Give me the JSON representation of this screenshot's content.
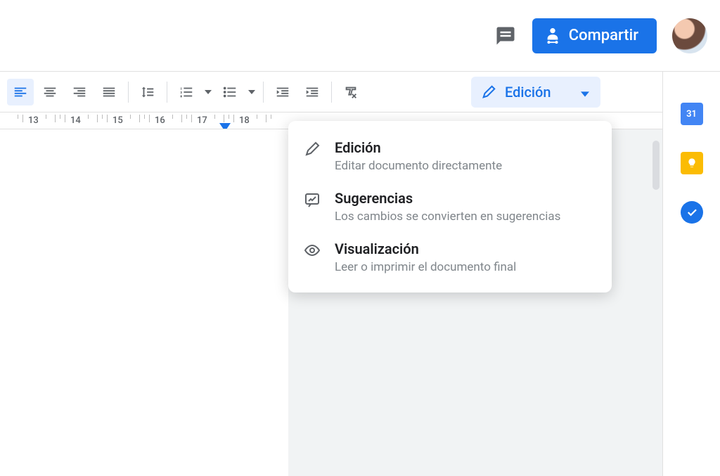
{
  "colors": {
    "primary": "#1a73e8",
    "primary_light": "#e8f0fe"
  },
  "header": {
    "share_label": "Compartir"
  },
  "toolbar": {
    "mode_label": "Edición"
  },
  "ruler": {
    "numbers": [
      "13",
      "14",
      "15",
      "16",
      "17",
      "18"
    ]
  },
  "mode_menu": [
    {
      "title": "Edición",
      "desc": "Editar documento directamente"
    },
    {
      "title": "Sugerencias",
      "desc": "Los cambios se convierten en sugerencias"
    },
    {
      "title": "Visualización",
      "desc": "Leer o imprimir el documento final"
    }
  ],
  "side": {
    "calendar_day": "31"
  }
}
